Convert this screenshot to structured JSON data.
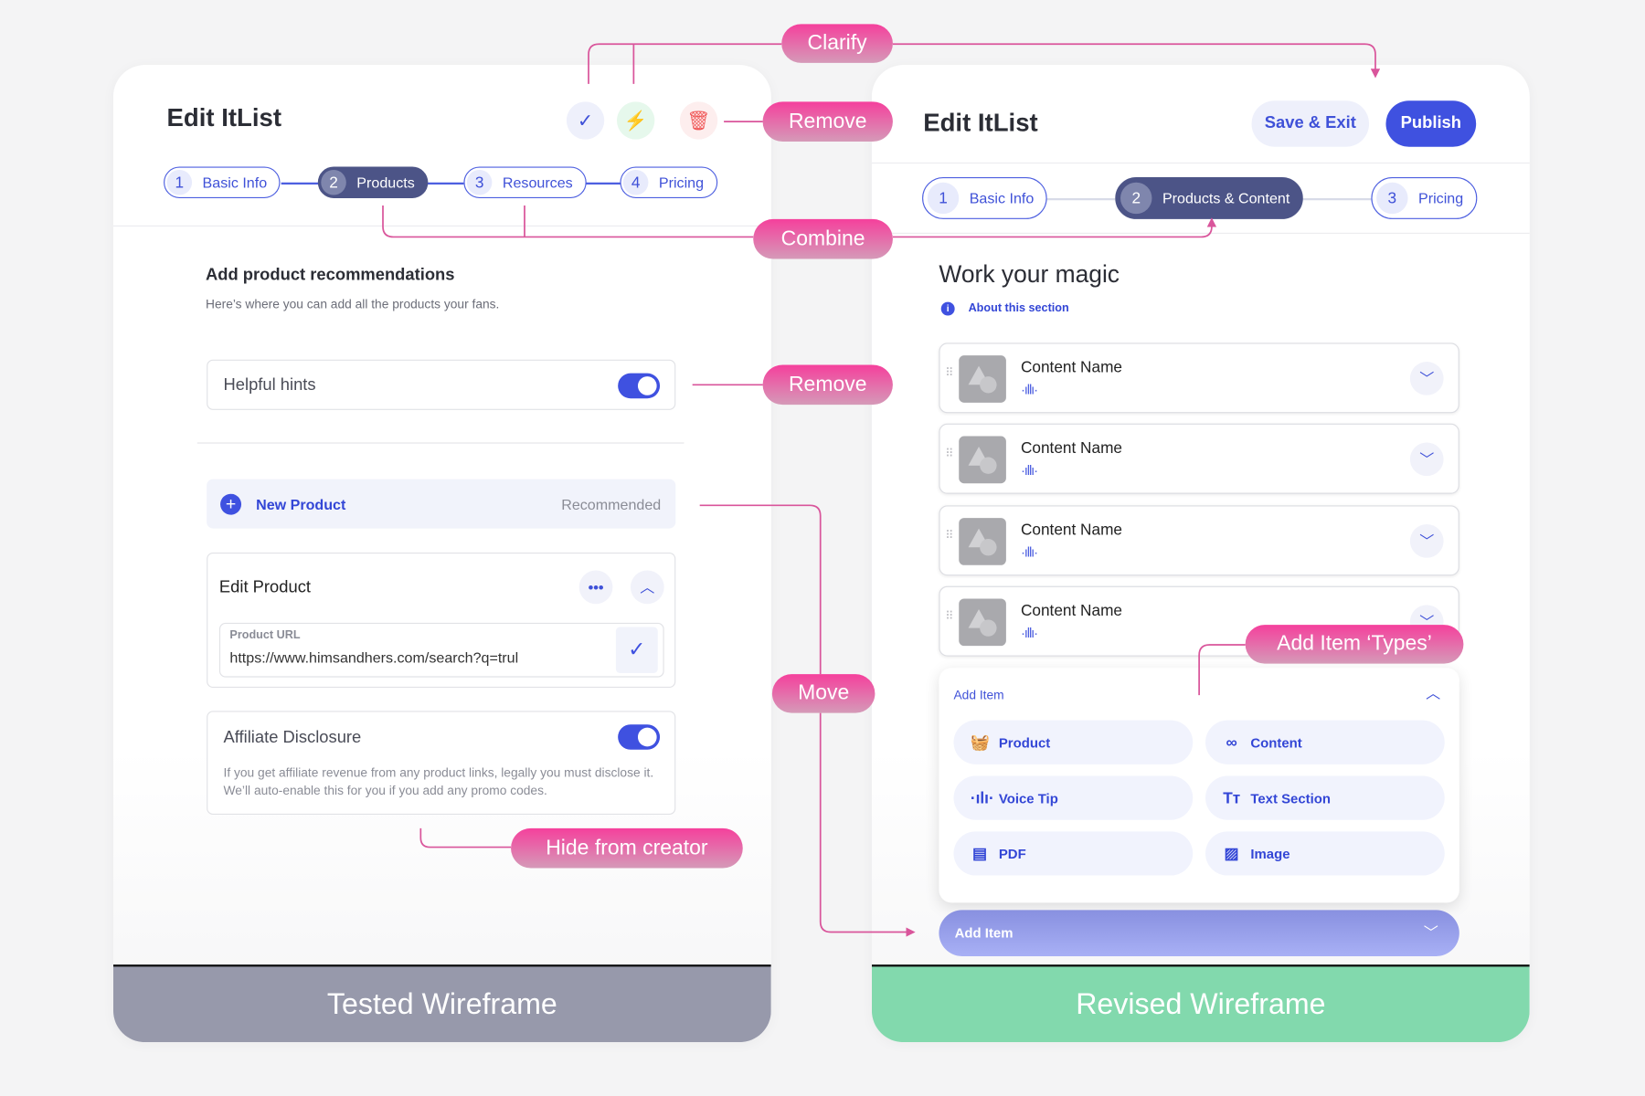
{
  "annotations": {
    "clarify": "Clarify",
    "remove_top": "Remove",
    "combine": "Combine",
    "remove_hints": "Remove",
    "move": "Move",
    "hide": "Hide from creator",
    "add_types": "Add Item ‘Types’"
  },
  "colors": {
    "accent": "#3f51e0",
    "annotation": "#f0479b",
    "tested_footer": "#9799ab",
    "revised_footer": "#82d9ad"
  },
  "tested": {
    "title": "Edit ItList",
    "icons": [
      "check-icon",
      "lightning-icon",
      "trash-icon"
    ],
    "steps": [
      {
        "num": "1",
        "label": "Basic Info"
      },
      {
        "num": "2",
        "label": "Products",
        "active": true
      },
      {
        "num": "3",
        "label": "Resources"
      },
      {
        "num": "4",
        "label": "Pricing"
      }
    ],
    "section_title": "Add product recommendations",
    "section_subtitle": "Here’s where you can add all the products your fans.",
    "helpful_hints": {
      "label": "Helpful hints",
      "enabled": true
    },
    "new_product": {
      "label": "New Product",
      "tag": "Recommended"
    },
    "edit_product": {
      "title": "Edit Product",
      "url_label": "Product URL",
      "url_value": "https://www.himsandhers.com/search?q=trul"
    },
    "affiliate": {
      "label": "Affiliate Disclosure",
      "enabled": true,
      "description": "If you get affiliate revenue from any product links, legally you must disclose it.  We’ll auto-enable this for you if you add any promo codes."
    },
    "footer": "Tested Wireframe"
  },
  "revised": {
    "title": "Edit ItList",
    "save_exit": "Save & Exit",
    "publish": "Publish",
    "steps": [
      {
        "num": "1",
        "label": "Basic Info"
      },
      {
        "num": "2",
        "label": "Products & Content",
        "active": true
      },
      {
        "num": "3",
        "label": "Pricing"
      }
    ],
    "section_title": "Work your magic",
    "about_link": "About this section",
    "items": [
      {
        "name": "Content Name"
      },
      {
        "name": "Content Name"
      },
      {
        "name": "Content Name"
      },
      {
        "name": "Content Name"
      }
    ],
    "add_item_panel": {
      "label": "Add Item",
      "types": [
        {
          "label": "Product",
          "icon": "basket-icon"
        },
        {
          "label": "Content",
          "icon": "link-icon"
        },
        {
          "label": "Voice Tip",
          "icon": "waveform-icon"
        },
        {
          "label": "Text Section",
          "icon": "text-size-icon"
        },
        {
          "label": "PDF",
          "icon": "document-icon"
        },
        {
          "label": "Image",
          "icon": "image-icon"
        }
      ]
    },
    "add_item_button": "Add Item",
    "footer": "Revised Wireframe"
  }
}
